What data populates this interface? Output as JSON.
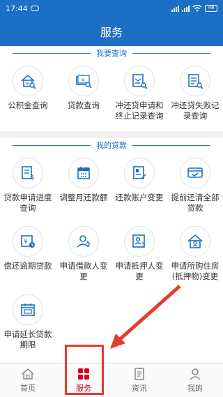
{
  "status": {
    "time": "17:44",
    "battery": "48"
  },
  "header": {
    "title": "服务"
  },
  "sections": [
    {
      "title": "我要查询",
      "items": [
        {
          "label": "公积金查询",
          "icon": "house-search-icon"
        },
        {
          "label": "贷款查询",
          "icon": "money-search-icon"
        },
        {
          "label": "冲还贷申请和终止记录查询",
          "icon": "record-search-icon"
        },
        {
          "label": "冲还贷失败记录查询",
          "icon": "failure-record-search-icon"
        }
      ]
    },
    {
      "title": "我的贷款",
      "items": [
        {
          "label": "贷款申请进度查询",
          "icon": "loan-progress-icon"
        },
        {
          "label": "调整月还款额",
          "icon": "calendar-icon"
        },
        {
          "label": "还款账户变更",
          "icon": "account-change-icon"
        },
        {
          "label": "提前还清全部贷款",
          "icon": "prepay-icon"
        },
        {
          "label": "偿还逾期贷款",
          "icon": "overdue-icon"
        },
        {
          "label": "申请借款人变更",
          "icon": "borrower-change-icon"
        },
        {
          "label": "申请抵押人变更",
          "icon": "mortgagor-change-icon"
        },
        {
          "label": "申请所购住房(抵押物)变更",
          "icon": "house-change-icon"
        },
        {
          "label": "申请延长贷款期限",
          "icon": "extend-term-icon"
        }
      ]
    }
  ],
  "tabs": [
    {
      "label": "首页",
      "icon": "home-icon"
    },
    {
      "label": "服务",
      "icon": "service-grid-icon"
    },
    {
      "label": "资讯",
      "icon": "news-icon"
    },
    {
      "label": "我的",
      "icon": "user-icon"
    }
  ],
  "colors": {
    "primary": "#1c6fc4",
    "active_tab": "#d0021b",
    "annotation": "#e63a2e"
  }
}
